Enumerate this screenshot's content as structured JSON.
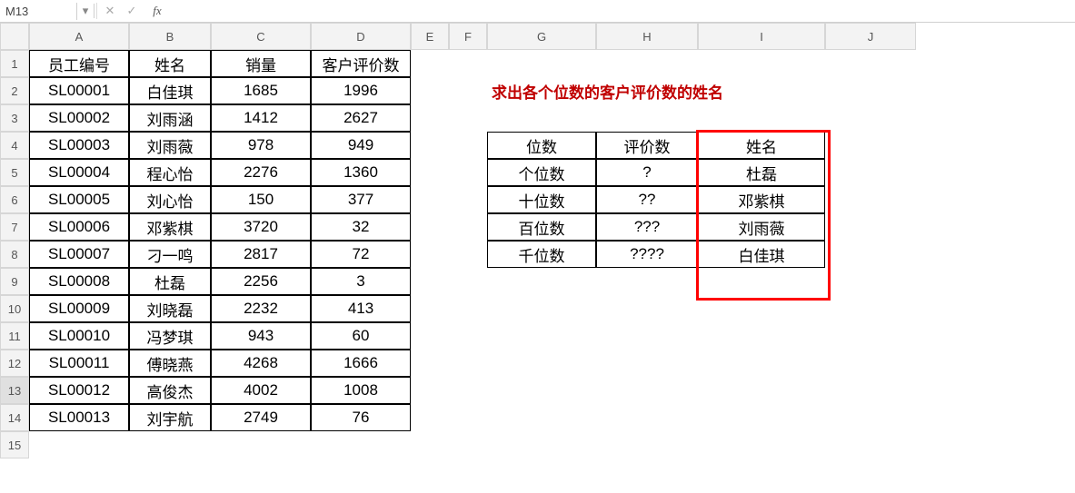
{
  "formula_bar": {
    "name_box": "M13",
    "dropdown_icon": "▾",
    "cancel_icon": "✕",
    "confirm_icon": "✓",
    "fx_label": "fx",
    "value": ""
  },
  "columns": [
    "A",
    "B",
    "C",
    "D",
    "E",
    "F",
    "G",
    "H",
    "I",
    "J"
  ],
  "rows": [
    "1",
    "2",
    "3",
    "4",
    "5",
    "6",
    "7",
    "8",
    "9",
    "10",
    "11",
    "12",
    "13",
    "14",
    "15"
  ],
  "main_table": {
    "headers": [
      "员工编号",
      "姓名",
      "销量",
      "客户评价数"
    ],
    "data": [
      [
        "SL00001",
        "白佳琪",
        "1685",
        "1996"
      ],
      [
        "SL00002",
        "刘雨涵",
        "1412",
        "2627"
      ],
      [
        "SL00003",
        "刘雨薇",
        "978",
        "949"
      ],
      [
        "SL00004",
        "程心怡",
        "2276",
        "1360"
      ],
      [
        "SL00005",
        "刘心怡",
        "150",
        "377"
      ],
      [
        "SL00006",
        "邓紫棋",
        "3720",
        "32"
      ],
      [
        "SL00007",
        "刁一鸣",
        "2817",
        "72"
      ],
      [
        "SL00008",
        "杜磊",
        "2256",
        "3"
      ],
      [
        "SL00009",
        "刘晓磊",
        "2232",
        "413"
      ],
      [
        "SL00010",
        "冯梦琪",
        "943",
        "60"
      ],
      [
        "SL00011",
        "傅晓燕",
        "4268",
        "1666"
      ],
      [
        "SL00012",
        "高俊杰",
        "4002",
        "1008"
      ],
      [
        "SL00013",
        "刘宇航",
        "2749",
        "76"
      ]
    ]
  },
  "instruction_text": "求出各个位数的客户评价数的姓名",
  "lookup_table": {
    "headers": [
      "位数",
      "评价数",
      "姓名"
    ],
    "rows": [
      [
        "个位数",
        "?",
        "杜磊"
      ],
      [
        "十位数",
        "??",
        "邓紫棋"
      ],
      [
        "百位数",
        "???",
        "刘雨薇"
      ],
      [
        "千位数",
        "????",
        "白佳琪"
      ]
    ]
  },
  "active_cell": "M13",
  "icons": {
    "name_box": "name-box",
    "dropdown": "dropdown-icon",
    "cancel": "cancel-icon",
    "confirm": "confirm-icon",
    "fx": "fx-icon"
  }
}
